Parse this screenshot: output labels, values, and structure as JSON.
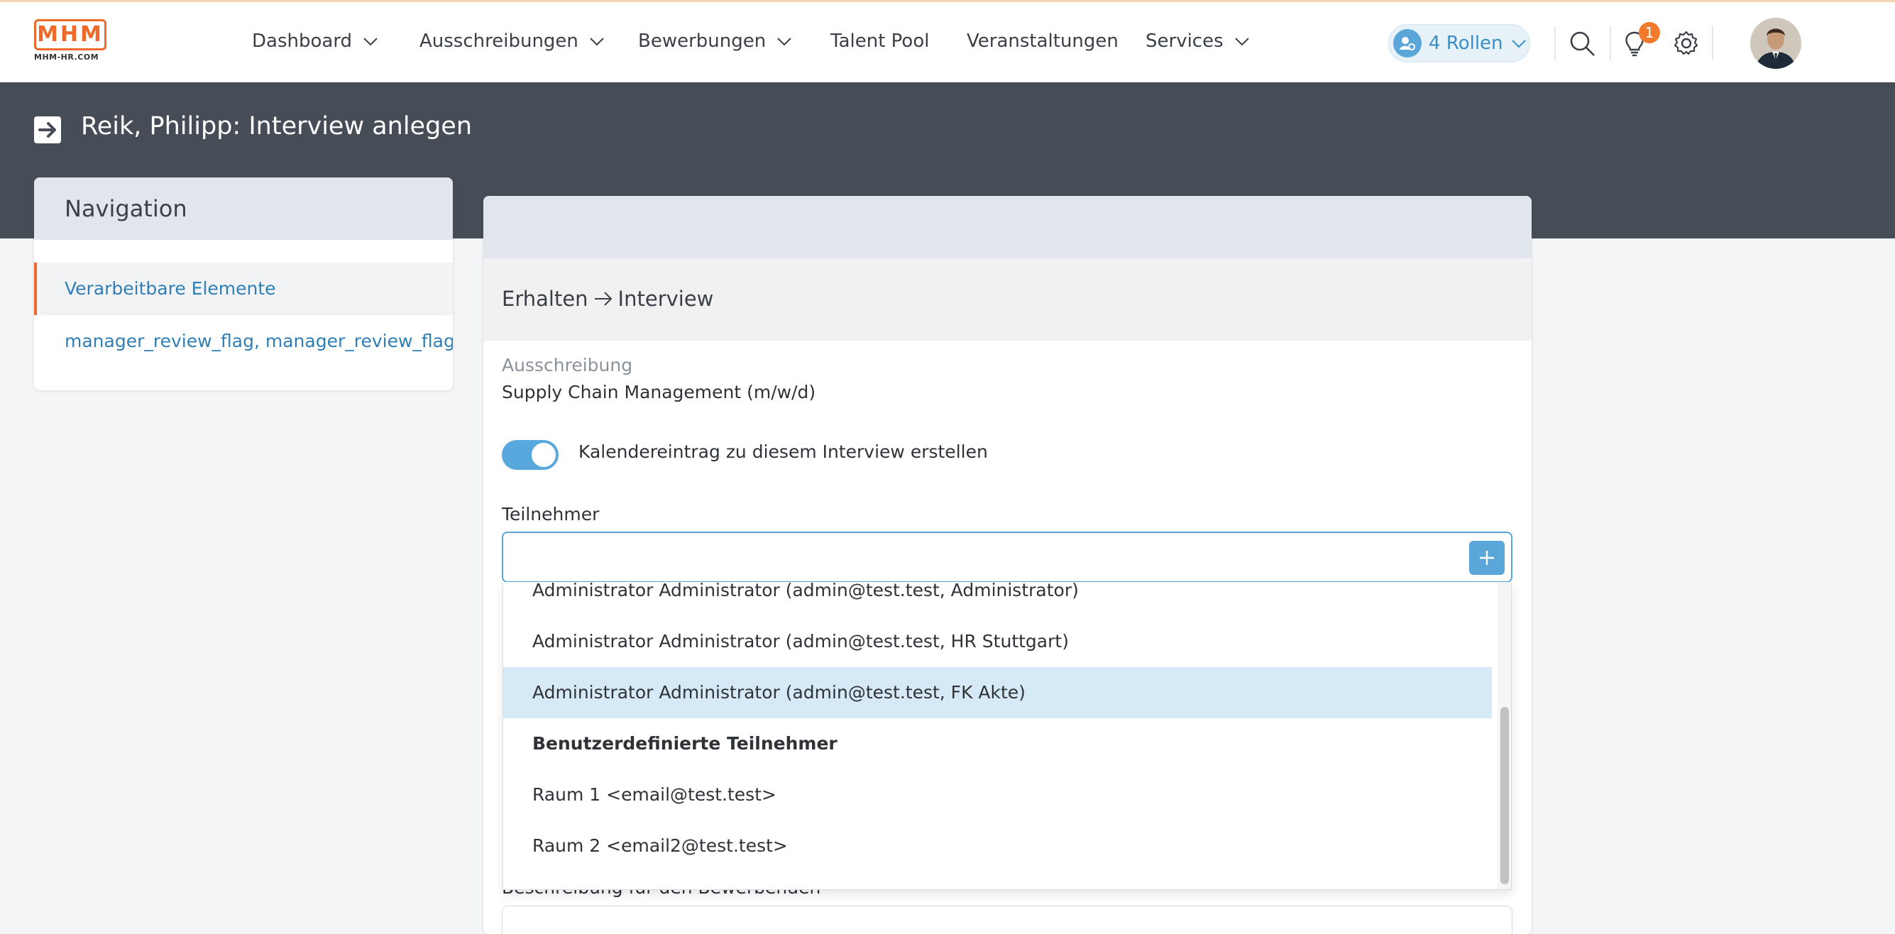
{
  "brand": {
    "logo_text": "MHM",
    "logo_sub": "MHM-HR.COM",
    "accent": "#ee6a2b"
  },
  "topnav": {
    "items": [
      {
        "label": "Dashboard",
        "has_dropdown": true
      },
      {
        "label": "Ausschreibungen",
        "has_dropdown": true
      },
      {
        "label": "Bewerbungen",
        "has_dropdown": true
      },
      {
        "label": "Talent Pool",
        "has_dropdown": false
      },
      {
        "label": "Veranstaltungen",
        "has_dropdown": false
      },
      {
        "label": "Services",
        "has_dropdown": true
      }
    ],
    "roles_label": "4 Rollen",
    "notification_count": "1",
    "icons": [
      "roles-icon",
      "search-icon",
      "lightbulb-icon",
      "gear-icon",
      "avatar"
    ]
  },
  "page": {
    "title": "Reik, Philipp: Interview anlegen",
    "header_color": "#474d57"
  },
  "sidebar": {
    "title": "Navigation",
    "items": [
      {
        "label": "Verarbeitbare Elemente",
        "active": true
      },
      {
        "label": "manager_review_flag, manager_review_flag",
        "active": false
      }
    ]
  },
  "form": {
    "step_from": "Erhalten",
    "step_to": "Interview",
    "posting_label": "Ausschreibung",
    "posting_value": "Supply Chain Management (m/w/d)",
    "calendar_toggle_label": "Kalendereintrag zu diesem Interview erstellen",
    "calendar_toggle_on": true,
    "participants_label": "Teilnehmer",
    "participants_value": "",
    "below_label": "Beschreibung für den Bewerbenden"
  },
  "dropdown": {
    "options": [
      {
        "label": "Administrator Administrator (admin@test.test, Administrator)",
        "type": "option"
      },
      {
        "label": "Administrator Administrator (admin@test.test, HR Stuttgart)",
        "type": "option"
      },
      {
        "label": "Administrator Administrator (admin@test.test, FK Akte)",
        "type": "option",
        "highlighted": true
      },
      {
        "label": "Benutzerdefinierte Teilnehmer",
        "type": "group"
      },
      {
        "label": "Raum 1 <email@test.test>",
        "type": "option"
      },
      {
        "label": "Raum 2 <email2@test.test>",
        "type": "option"
      }
    ]
  }
}
